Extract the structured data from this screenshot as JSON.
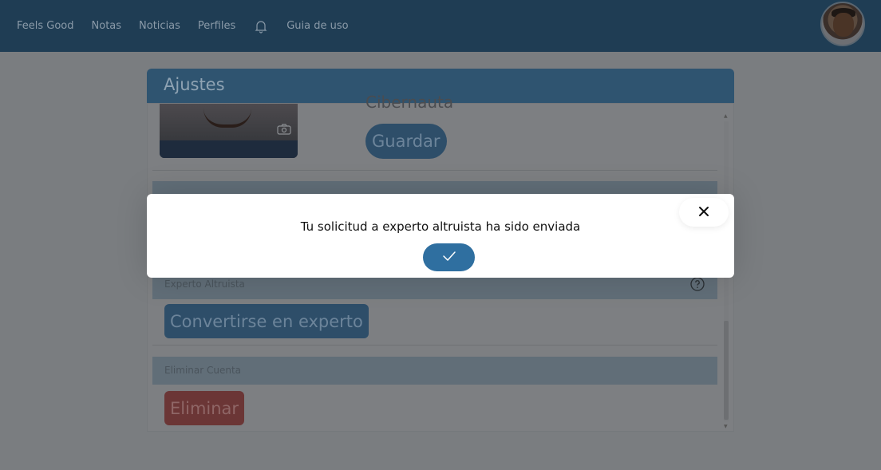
{
  "nav": {
    "items": [
      {
        "label": "Feels Good"
      },
      {
        "label": "Notas"
      },
      {
        "label": "Noticias"
      },
      {
        "label": "Perfiles"
      }
    ],
    "guide_label": "Guia de uso"
  },
  "settings": {
    "title": "Ajustes",
    "username": "Cibernauta",
    "save_label": "Guardar",
    "section_1_label": "",
    "section_2_label": "Experto Altruista",
    "expert_button_label": "Convertirse en experto",
    "section_3_label": "Eliminar Cuenta",
    "delete_button_label": "Eliminar"
  },
  "modal": {
    "message": "Tu solicitud a experto altruista ha sido enviada",
    "ok_icon": "check-icon",
    "close_icon": "close-icon"
  },
  "colors": {
    "navbar": "#1f3d54",
    "primary_button": "#2f6fa0",
    "danger_button": "#b34a4a"
  }
}
